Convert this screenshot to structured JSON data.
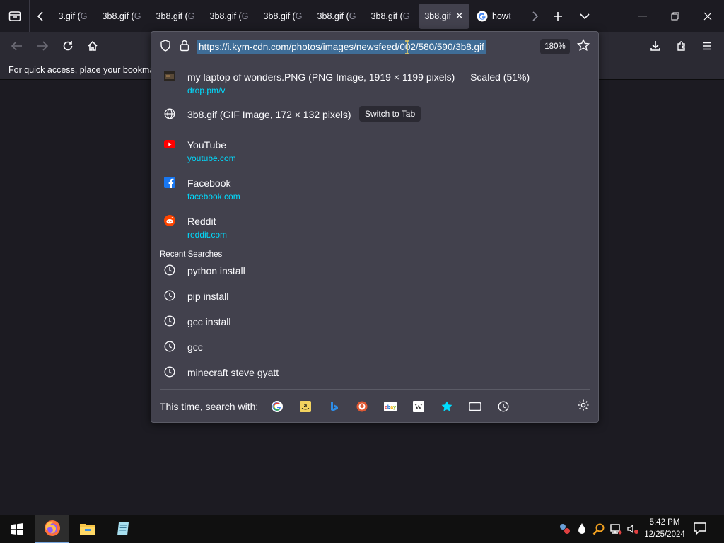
{
  "tabstrip": {
    "tabs": [
      {
        "main": "3.gif (",
        "fade": "G"
      },
      {
        "main": "3b8.gif (",
        "fade": "G"
      },
      {
        "main": "3b8.gif (",
        "fade": "G"
      },
      {
        "main": "3b8.gif (",
        "fade": "G"
      },
      {
        "main": "3b8.gif (",
        "fade": "G"
      },
      {
        "main": "3b8.gif (",
        "fade": "G"
      },
      {
        "main": "3b8.gif (",
        "fade": "G"
      }
    ],
    "active_tab": {
      "main": "3b8.gi",
      "fade": "f"
    },
    "google_tab": {
      "main": "how",
      "fade": " t"
    }
  },
  "bookmarks_bar": {
    "hint": "For quick access, place your bookmark"
  },
  "urlbar": {
    "url": "https://i.kym-cdn.com/photos/images/newsfeed/002/580/590/3b8.gif",
    "zoom": "180%"
  },
  "results": [
    {
      "icon": "image-thumbnail-icon",
      "title": "my laptop of wonders.PNG (PNG Image, 1919 × 1199 pixels) — Scaled (51%)",
      "sub": "drop.pm/v"
    },
    {
      "icon": "globe-icon",
      "title": "3b8.gif (GIF Image, 172 × 132 pixels)",
      "action": "Switch to Tab"
    },
    {
      "icon": "youtube-icon",
      "title": "YouTube",
      "sub": "youtube.com"
    },
    {
      "icon": "facebook-icon",
      "title": "Facebook",
      "sub": "facebook.com"
    },
    {
      "icon": "reddit-icon",
      "title": "Reddit",
      "sub": "reddit.com"
    }
  ],
  "recent_searches": {
    "heading": "Recent Searches",
    "items": [
      "python install",
      "pip install",
      "gcc install",
      "gcc",
      "minecraft steve gyatt"
    ]
  },
  "search_with": {
    "label": "This time, search with:",
    "engines": [
      "google-icon",
      "amazon-icon",
      "bing-icon",
      "duckduckgo-icon",
      "ebay-icon",
      "wikipedia-icon",
      "bookmarks-star-icon",
      "tabs-icon",
      "history-icon"
    ]
  },
  "taskbar": {
    "time": "5:42 PM",
    "date": "12/25/2024"
  },
  "colors": {
    "accent": "#00ddff",
    "url_highlight": "#3f6d97",
    "panel": "#42414d",
    "toolbar": "#2b2a33"
  }
}
